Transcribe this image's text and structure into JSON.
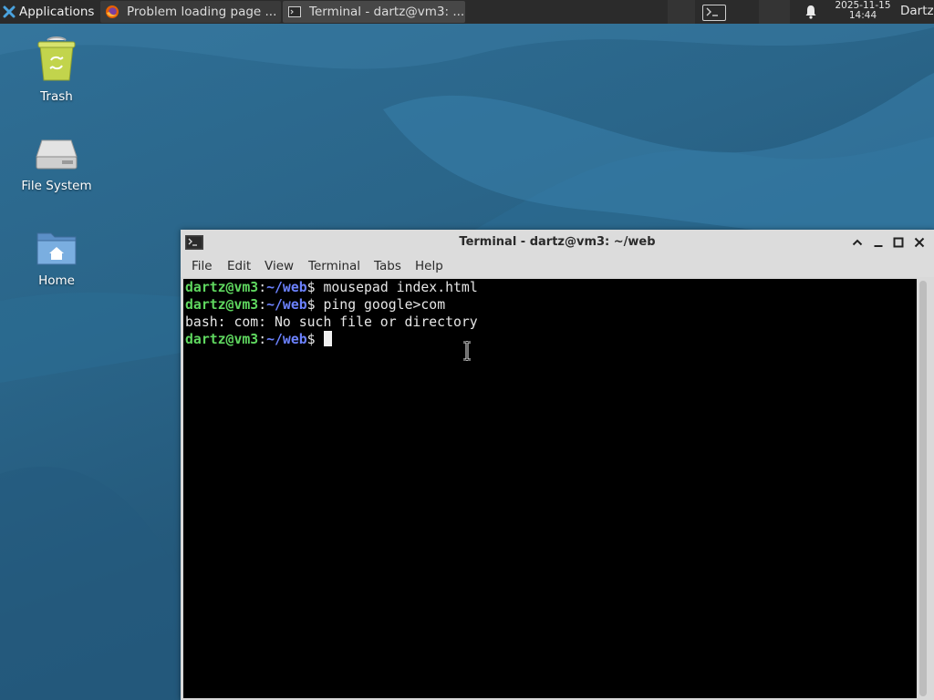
{
  "panel": {
    "applications_label": "Applications",
    "tasks": [
      {
        "label": "Problem loading page ...",
        "icon": "firefox-icon"
      },
      {
        "label": "Terminal - dartz@vm3: ...",
        "icon": "terminal-icon"
      }
    ],
    "clock": {
      "date": "2025-11-15",
      "time": "14:44"
    },
    "user": "Dartz"
  },
  "desktop": {
    "icons": [
      {
        "label": "Trash",
        "icon": "trash-icon"
      },
      {
        "label": "File System",
        "icon": "drive-icon"
      },
      {
        "label": "Home",
        "icon": "home-folder-icon"
      }
    ]
  },
  "terminal": {
    "title": "Terminal - dartz@vm3: ~/web",
    "menu": [
      "File",
      "Edit",
      "View",
      "Terminal",
      "Tabs",
      "Help"
    ],
    "lines": [
      {
        "user": "dartz@vm3",
        "sep": ":",
        "path": "~/web",
        "sym": "$",
        "cmd": " mousepad index.html"
      },
      {
        "user": "dartz@vm3",
        "sep": ":",
        "path": "~/web",
        "sym": "$",
        "cmd": " ping google>com"
      },
      {
        "output": "bash: com: No such file or directory"
      },
      {
        "user": "dartz@vm3",
        "sep": ":",
        "path": "~/web",
        "sym": "$",
        "cmd": " "
      }
    ]
  },
  "colors": {
    "prompt_user": "#5fd75f",
    "prompt_path": "#6c82ff",
    "terminal_bg": "#000000",
    "panel_bg": "#2b2b2b"
  }
}
